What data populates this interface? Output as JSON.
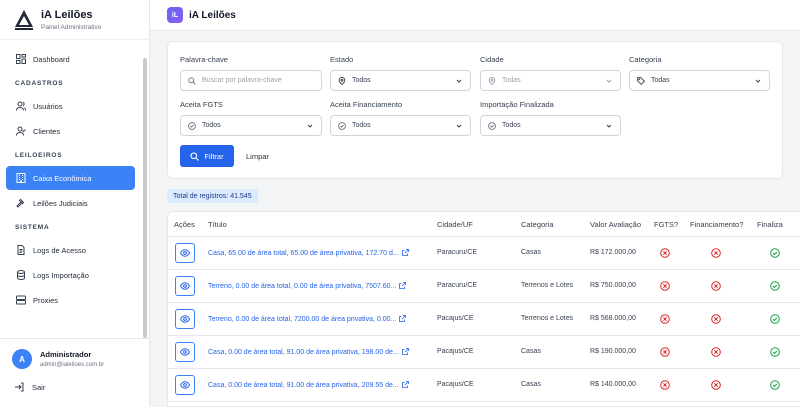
{
  "brand": {
    "title": "iA Leilões",
    "subtitle": "Painel Administrativo"
  },
  "sidebar": {
    "dashboard": "Dashboard",
    "section_cadastros": "CADASTROS",
    "usuarios": "Usuários",
    "clientes": "Clientes",
    "section_leiloeiros": "LEILOEIROS",
    "caixa": "Caixa Econômica",
    "judiciais": "Leilões Judiciais",
    "section_sistema": "SISTEMA",
    "logs_acesso": "Logs de Acesso",
    "logs_importacao": "Logs Importação",
    "proxies": "Proxies"
  },
  "user": {
    "initial": "A",
    "name": "Administrador",
    "email": "admin@ialeiloes.com.br",
    "logout": "Sair"
  },
  "topbar": {
    "logo": "iL",
    "title": "iA Leilões"
  },
  "filters": {
    "keyword_label": "Palavra-chave",
    "keyword_placeholder": "Buscar por palavra-chave",
    "estado_label": "Estado",
    "estado_value": "Todos",
    "cidade_label": "Cidade",
    "cidade_value": "Todas",
    "categoria_label": "Categoria",
    "categoria_value": "Todas",
    "fgts_label": "Aceita FGTS",
    "fgts_value": "Todos",
    "financiamento_label": "Aceita Financiamento",
    "financiamento_value": "Todos",
    "importacao_label": "Importação Finalizada",
    "importacao_value": "Todos",
    "filter_button": "Filtrar",
    "clear_button": "Limpar"
  },
  "total_label": "Total de registros: 41.545",
  "table": {
    "headers": {
      "acoes": "Ações",
      "titulo": "Título",
      "cidade": "Cidade/UF",
      "categoria": "Categoria",
      "valor": "Valor Avaliação",
      "fgts": "FGTS?",
      "financiamento": "Financiamento?",
      "finalizada": "Finaliza"
    },
    "rows": [
      {
        "titulo": "Casa, 65.00 de área total, 65.00 de área privativa, 172.70 d...",
        "cidade": "Paracuru/CE",
        "categoria": "Casas",
        "valor": "R$ 172.000,00",
        "fgts": false,
        "financiamento": false,
        "finalizada": true
      },
      {
        "titulo": "Terreno, 0.00 de área total, 0.00 de área privativa, 7507.60...",
        "cidade": "Paracuru/CE",
        "categoria": "Terrenos e Lotes",
        "valor": "R$ 750.000,00",
        "fgts": false,
        "financiamento": false,
        "finalizada": true
      },
      {
        "titulo": "Terreno, 0.00 de área total, 7200.00 de área privativa, 0.00...",
        "cidade": "Pacajus/CE",
        "categoria": "Terrenos e Lotes",
        "valor": "R$ 568.000,00",
        "fgts": false,
        "financiamento": false,
        "finalizada": true
      },
      {
        "titulo": "Casa, 0.00 de área total, 91.00 de área privativa, 198.00 de...",
        "cidade": "Pacajus/CE",
        "categoria": "Casas",
        "valor": "R$ 190.000,00",
        "fgts": false,
        "financiamento": false,
        "finalizada": true
      },
      {
        "titulo": "Casa, 0.00 de área total, 91.00 de área privativa, 209.55 de...",
        "cidade": "Pacajus/CE",
        "categoria": "Casas",
        "valor": "R$ 140.000,00",
        "fgts": false,
        "financiamento": false,
        "finalizada": true
      }
    ]
  },
  "colors": {
    "primary": "#2563eb",
    "active": "#3b82f6",
    "error": "#dc2626",
    "success": "#16a34a"
  }
}
